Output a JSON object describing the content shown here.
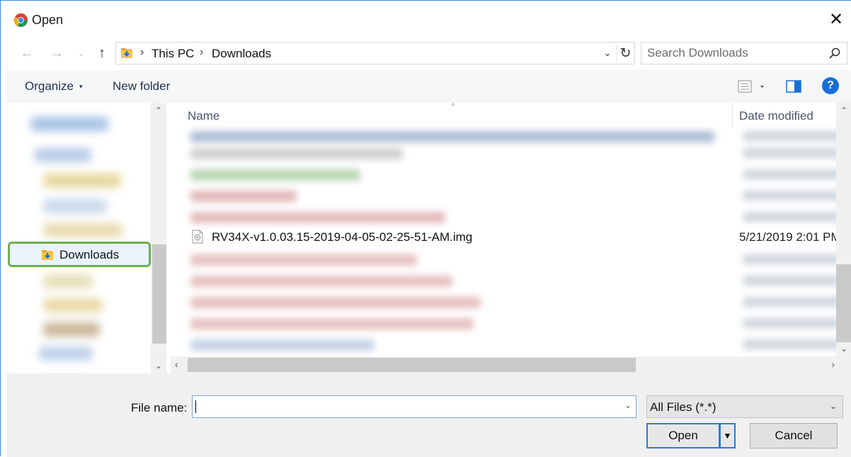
{
  "window": {
    "title": "Open",
    "close_glyph": "✕",
    "app_icon": "chrome-icon"
  },
  "navigation": {
    "back_glyph": "←",
    "forward_glyph": "→",
    "recent_glyph": "⌄",
    "up_glyph": "↑"
  },
  "address": {
    "separator": "›",
    "crumbs": [
      "This PC",
      "Downloads"
    ],
    "dropdown_glyph": "⌄",
    "refresh_glyph": "↻"
  },
  "search": {
    "placeholder": "Search Downloads",
    "value": ""
  },
  "toolbar": {
    "organize_label": "Organize",
    "organize_caret": "▾",
    "new_folder_label": "New folder",
    "help_label": "?"
  },
  "nav_pane": {
    "selected_item": "Downloads",
    "scroll_up": "⌃",
    "scroll_down": "⌄"
  },
  "file_list": {
    "columns": {
      "name": "Name",
      "date_modified": "Date modified",
      "sort_glyph": "^"
    },
    "visible_file": {
      "name": "RV34X-v1.0.03.15-2019-04-05-02-25-51-AM.img",
      "date_modified": "5/21/2019 2:01 PM"
    },
    "scroll_up": "⌃",
    "scroll_down": "⌄",
    "scroll_left": "‹",
    "scroll_right": "›"
  },
  "footer": {
    "file_name_label": "File name:",
    "file_name_value": "",
    "file_name_dd": "⌄",
    "filter_label": "All Files (*.*)",
    "filter_dd": "⌄",
    "open_label": "Open",
    "open_split_glyph": "▼",
    "cancel_label": "Cancel"
  },
  "colors": {
    "accent": "#2f7ad6",
    "selection_highlight": "#6ab04c",
    "help_blue": "#1a6fd6"
  }
}
